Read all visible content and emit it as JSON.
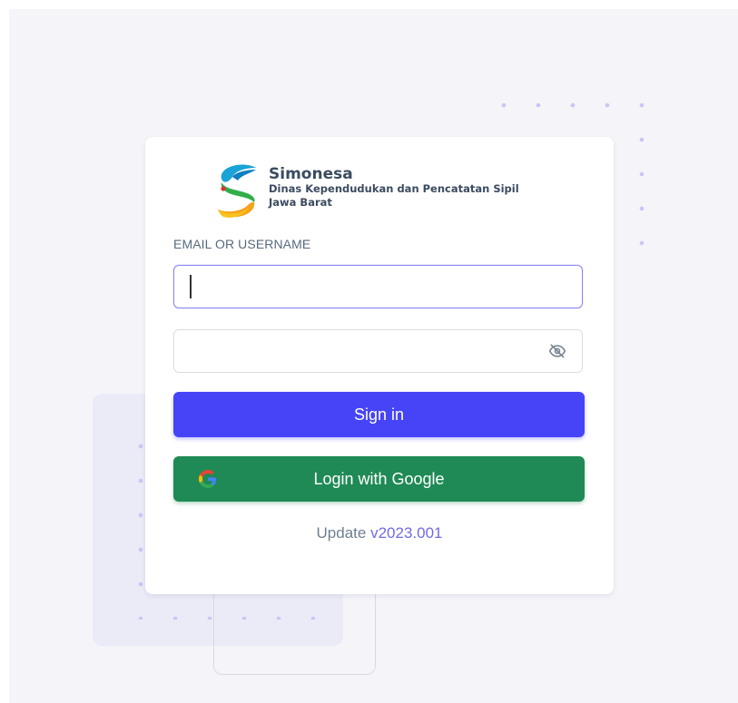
{
  "brand": {
    "logo_icon": "simonesa-logo-icon",
    "name": "Simonesa",
    "subtitle_line1": "Dinas Kependudukan dan Pencatatan Sipil",
    "subtitle_line2": "Jawa Barat"
  },
  "form": {
    "email_label": "EMAIL OR USERNAME",
    "email_value": "",
    "email_placeholder": "",
    "password_value": "",
    "password_placeholder": "",
    "password_toggle_icon": "eye-off-icon",
    "signin_label": "Sign in",
    "google_label": "Login with Google",
    "google_icon": "google-icon"
  },
  "footer": {
    "update_label": "Update",
    "version": "v2023.001"
  },
  "colors": {
    "primary": "#4644f7",
    "google_button": "#1f8a55",
    "version_link": "#6e6be8",
    "background": "#f5f5f9"
  }
}
